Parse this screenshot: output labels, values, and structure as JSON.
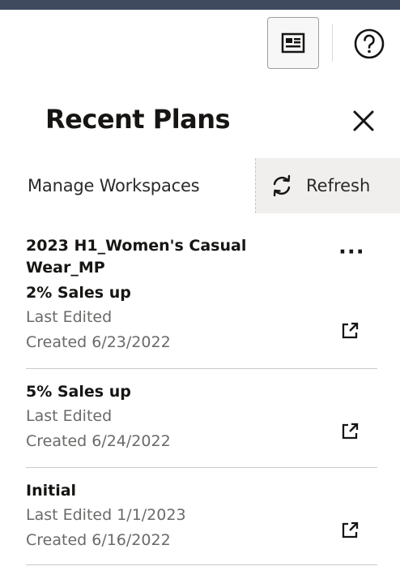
{
  "toolbar": {
    "panel_icon": "id-card-icon",
    "help_icon": "help-circle-icon"
  },
  "panel": {
    "title": "Recent Plans",
    "close_icon": "close-icon",
    "tabs": {
      "manage_label": "Manage Workspaces",
      "refresh_label": "Refresh",
      "refresh_icon": "refresh-icon"
    },
    "plans": [
      {
        "workspace": "2023 H1_Women's Casual Wear_MP",
        "workspace_line1": "2023 H1_Women's Casual",
        "workspace_line2": "Wear_MP",
        "more_label": "···",
        "name": "2% Sales up",
        "last_edited": "Last Edited",
        "created": "Created 6/23/2022"
      },
      {
        "name": "5% Sales up",
        "last_edited": "Last Edited",
        "created": "Created 6/24/2022"
      },
      {
        "name": "Initial",
        "last_edited": "Last Edited 1/1/2023",
        "created": "Created 6/16/2022"
      }
    ]
  }
}
